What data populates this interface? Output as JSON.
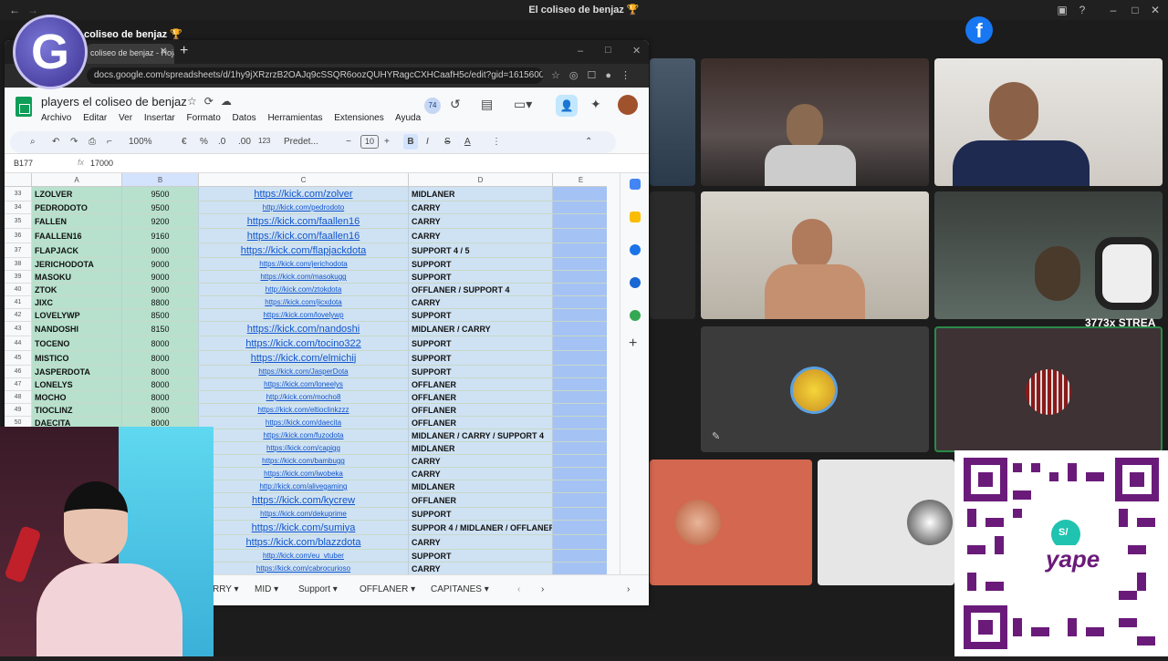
{
  "window": {
    "title": "El coliseo de benjaz 🏆",
    "channel": "coliseo de benjaz 🏆"
  },
  "browser": {
    "tab_title": "coliseo de benjaz - Hoja",
    "url": "docs.google.com/spreadsheets/d/1hy9jXRzrzB2OAJq9cSSQR6oozQUHYRagcCXHCaafH5c/edit?gid=1615600466#gi..."
  },
  "sheets": {
    "title": "players el coliseo de benjaz",
    "menu": [
      "Archivo",
      "Editar",
      "Ver",
      "Insertar",
      "Formato",
      "Datos",
      "Herramientas",
      "Extensiones",
      "Ayuda"
    ],
    "collaborators": "74",
    "toolbar": {
      "zoom": "100%",
      "currency": "€",
      "percent": "%",
      "dec_minus": ".0",
      "dec_plus": ".00",
      "format_123": "123",
      "font": "Predet...",
      "font_size": "10",
      "bold": "B",
      "italic": "I",
      "strike": "S",
      "text_color": "A"
    },
    "name_box": "B177",
    "formula_value": "17000",
    "columns": [
      "A",
      "B",
      "C",
      "D",
      "E"
    ],
    "rows": [
      {
        "n": "33",
        "name": "LZOLVER",
        "mmr": "9500",
        "link": "https://kick.com/zolver",
        "role": "MIDLANER",
        "big": true
      },
      {
        "n": "34",
        "name": "PEDRODOTO",
        "mmr": "9500",
        "link": "http://kick.com/pedrodoto",
        "role": "CARRY",
        "big": false
      },
      {
        "n": "35",
        "name": "FALLEN",
        "mmr": "9200",
        "link": "https://kick.com/faallen16",
        "role": "CARRY",
        "big": true
      },
      {
        "n": "36",
        "name": "FAALLEN16",
        "mmr": "9160",
        "link": "https://kick.com/faallen16",
        "role": "CARRY",
        "big": true
      },
      {
        "n": "37",
        "name": "FLAPJACK",
        "mmr": "9000",
        "link": "https://kick.com/flapjackdota",
        "role": "SUPPORT 4 / 5",
        "big": true
      },
      {
        "n": "38",
        "name": "JERICHODOTA",
        "mmr": "9000",
        "link": "https://kick.com/jerichodota",
        "role": "SUPPORT",
        "big": false
      },
      {
        "n": "39",
        "name": "MASOKU",
        "mmr": "9000",
        "link": "https://kick.com/masokugg",
        "role": "SUPPORT",
        "big": false
      },
      {
        "n": "40",
        "name": "ZTOK",
        "mmr": "9000",
        "link": "http://kick.com/ztokdota",
        "role": "OFFLANER / SUPPORT 4",
        "big": false
      },
      {
        "n": "41",
        "name": "JIXC",
        "mmr": "8800",
        "link": "https://kick.com/jicxdota",
        "role": "CARRY",
        "big": false
      },
      {
        "n": "42",
        "name": "LOVELYWP",
        "mmr": "8500",
        "link": "https://kick.com/lovelywp",
        "role": "SUPPORT",
        "big": false
      },
      {
        "n": "43",
        "name": "NANDOSHI",
        "mmr": "8150",
        "link": "https://kick.com/nandoshi",
        "role": "MIDLANER / CARRY",
        "big": true
      },
      {
        "n": "44",
        "name": "TOCENO",
        "mmr": "8000",
        "link": "https://kick.com/tocino322",
        "role": "SUPPORT",
        "big": true
      },
      {
        "n": "45",
        "name": "MISTICO",
        "mmr": "8000",
        "link": "https://kick.com/elmichij",
        "role": "SUPPORT",
        "big": true
      },
      {
        "n": "46",
        "name": "JASPERDOTA",
        "mmr": "8000",
        "link": "https://kick.com/JasperDota",
        "role": "SUPPORT",
        "big": false
      },
      {
        "n": "47",
        "name": "LONELYS",
        "mmr": "8000",
        "link": "https://kick.com/loneelys",
        "role": "OFFLANER",
        "big": false
      },
      {
        "n": "48",
        "name": "MOCHO",
        "mmr": "8000",
        "link": "http://kick.com/mocho8",
        "role": "OFFLANER",
        "big": false
      },
      {
        "n": "49",
        "name": "TIOCLINZ",
        "mmr": "8000",
        "link": "https://kick.com/eltioclinkzzz",
        "role": "OFFLANER",
        "big": false
      },
      {
        "n": "50",
        "name": "DAECITA",
        "mmr": "8000",
        "link": "https://kick.com/daecita",
        "role": "OFFLANER",
        "big": false
      },
      {
        "n": "",
        "name": "",
        "mmr": "",
        "link": "https://kick.com/fuzodota",
        "role": "MIDLANER / CARRY / SUPPORT 4",
        "big": false
      },
      {
        "n": "",
        "name": "",
        "mmr": "",
        "link": "https://kick.com/capigg",
        "role": "MIDLANER",
        "big": false
      },
      {
        "n": "",
        "name": "",
        "mmr": "",
        "link": "https://kick.com/bambugg",
        "role": "CARRY",
        "big": false
      },
      {
        "n": "",
        "name": "",
        "mmr": "",
        "link": "https://kick.com/iwobeka",
        "role": "CARRY",
        "big": false
      },
      {
        "n": "",
        "name": "",
        "mmr": "",
        "link": "http://kick.com/alivegaming",
        "role": "MIDLANER",
        "big": false
      },
      {
        "n": "",
        "name": "",
        "mmr": "",
        "link": "https://kick.com/kycrew",
        "role": "OFFLANER",
        "big": true
      },
      {
        "n": "",
        "name": "",
        "mmr": "",
        "link": "https://kick.com/dekuprime",
        "role": "SUPPORT",
        "big": false
      },
      {
        "n": "",
        "name": "",
        "mmr": "",
        "link": "https://kick.com/sumiya",
        "role": "SUPPOR 4 / MIDLANER / OFFLANER",
        "big": true
      },
      {
        "n": "",
        "name": "",
        "mmr": "",
        "link": "https://kick.com/blazzdota",
        "role": "CARRY",
        "big": true
      },
      {
        "n": "",
        "name": "",
        "mmr": "",
        "link": "http://kick.com/eu_vtuber",
        "role": "SUPPORT",
        "big": false
      },
      {
        "n": "",
        "name": "",
        "mmr": "",
        "link": "https://kick.com/cabrocurioso",
        "role": "CARRY",
        "big": false
      }
    ],
    "sheet_tabs": [
      "RRY",
      "MID",
      "Support",
      "OFFLANER",
      "CAPITANES"
    ]
  },
  "overlay": {
    "stream_text": "3773x STREA",
    "payment_brand": "yape",
    "payment_currency": "S/"
  },
  "colors": {
    "green_col": "#b7e1cd",
    "blue_col": "#cfe2f3",
    "accent": "#1877f2"
  }
}
